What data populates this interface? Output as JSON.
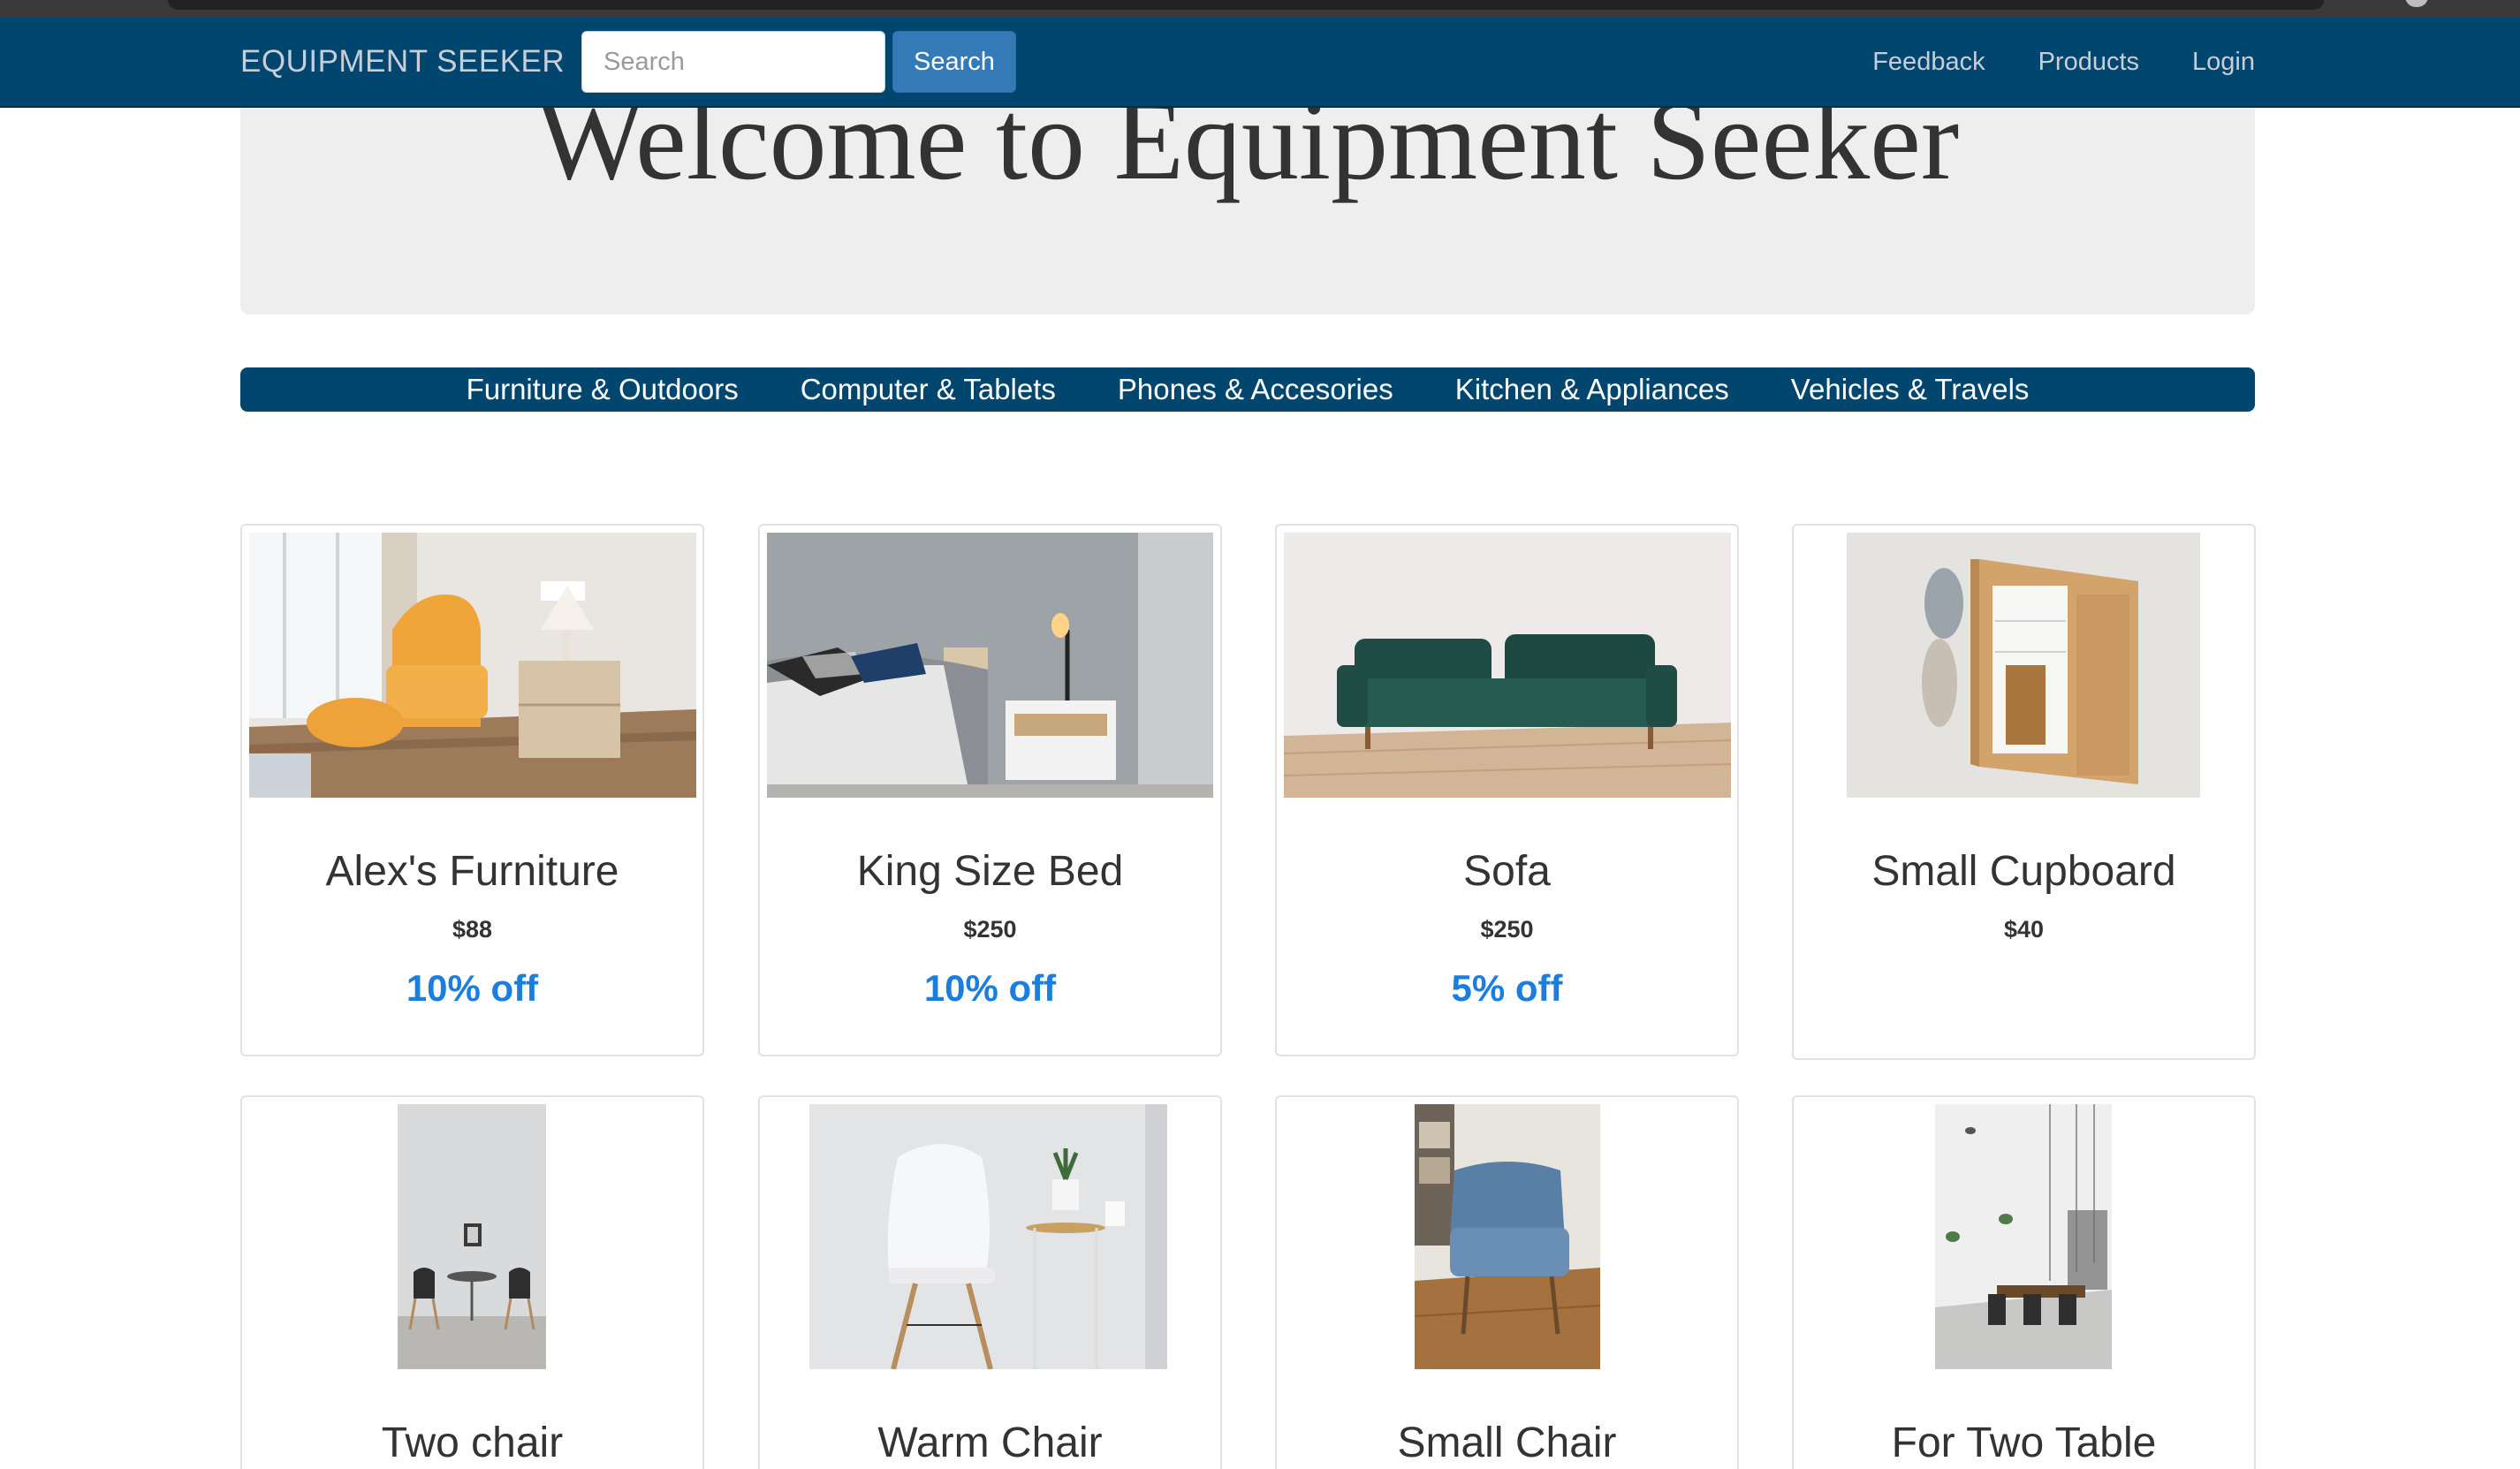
{
  "navbar": {
    "brand": "EQUIPMENT SEEKER",
    "search_placeholder": "Search",
    "search_button": "Search",
    "links": [
      "Feedback",
      "Products",
      "Login"
    ]
  },
  "jumbotron": {
    "title": "Welcome to Equipment Seeker"
  },
  "categories": [
    "Furniture & Outdoors",
    "Computer & Tablets",
    "Phones & Accesories",
    "Kitchen & Appliances",
    "Vehicles & Travels"
  ],
  "products": [
    {
      "name": "Alex's Furniture",
      "price": "$88",
      "discount": "10% off",
      "image": "armchair-room-photo"
    },
    {
      "name": "King Size Bed",
      "price": "$250",
      "discount": "10% off",
      "image": "bed-photo"
    },
    {
      "name": "Sofa",
      "price": "$250",
      "discount": "5% off",
      "image": "sofa-photo"
    },
    {
      "name": "Small Cupboard",
      "price": "$40",
      "discount": "",
      "image": "cupboard-photo"
    },
    {
      "name": "Two chair",
      "image": "two-chair-photo"
    },
    {
      "name": "Warm Chair",
      "image": "white-chair-photo"
    },
    {
      "name": "Small Chair",
      "image": "blue-chair-photo"
    },
    {
      "name": "For Two Table",
      "image": "dining-table-photo"
    }
  ],
  "colors": {
    "navbar": "#00466e",
    "search_button": "#337ab7",
    "discount": "#1a7ee0",
    "jumbotron": "#eeeeee"
  }
}
